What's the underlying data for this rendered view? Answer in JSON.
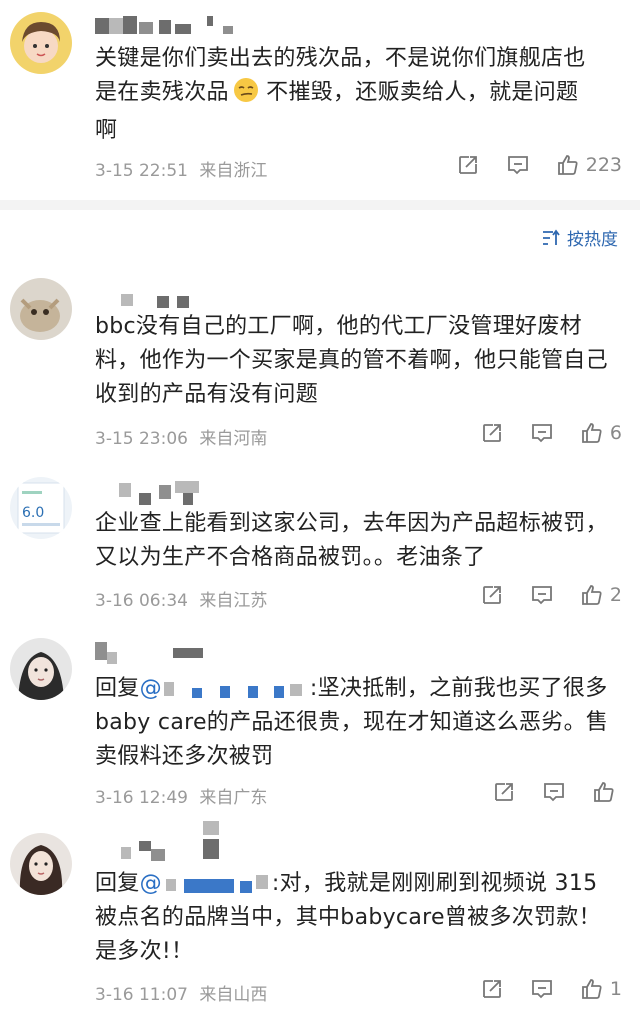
{
  "top_comment": {
    "text": "关键是你们卖出去的残次品，不是说你们旗舰店也是在卖残次品😌不摧毁，还贩卖给人，就是问题啊",
    "text_line1": "关键是你们卖出去的残次品，不是说你们旗舰店也",
    "text_line2a": "是在卖残次品",
    "text_line2b": " 不摧毁，还贩卖给人，就是问题",
    "text_line3": "啊",
    "time": "3-15 22:51",
    "location": "来自浙江",
    "likes": "223"
  },
  "sort": {
    "label": "按热度"
  },
  "comments": [
    {
      "lines": [
        "bbc没有自己的工厂啊，他的代工厂没管理好废材",
        "料，他作为一个买家是真的管不着啊，他只能管自己",
        "收到的产品有没有问题"
      ],
      "time": "3-15 23:06",
      "location": "来自河南",
      "likes": "6"
    },
    {
      "lines": [
        "企业查上能看到这家公司，去年因为产品超标被罚，",
        "又以为生产不合格商品被罚。。老油条了"
      ],
      "time": "3-16 06:34",
      "location": "来自江苏",
      "likes": "2"
    },
    {
      "reply_prefix": "回复",
      "mention": "@",
      "after_mention": ":坚决抵制，之前我也买了很多",
      "lines": [
        "baby care的产品还很贵，现在才知道这么恶劣。售",
        "卖假料还多次被罚"
      ],
      "time": "3-16 12:49",
      "location": "来自广东",
      "likes": ""
    },
    {
      "reply_prefix": "回复",
      "mention": "@",
      "after_mention": ":对，我就是刚刚刷到视频说 315",
      "lines": [
        "被点名的品牌当中，其中babycare曾被多次罚款！",
        "是多次!！"
      ],
      "time": "3-16 11:07",
      "location": "来自山西",
      "likes": "1"
    }
  ],
  "colors": {
    "link": "#2a6fc4",
    "meta": "#9a9a9a",
    "divider": "#f3f3f3"
  },
  "icons": [
    "repost-icon",
    "comment-icon",
    "like-icon",
    "sort-icon"
  ]
}
